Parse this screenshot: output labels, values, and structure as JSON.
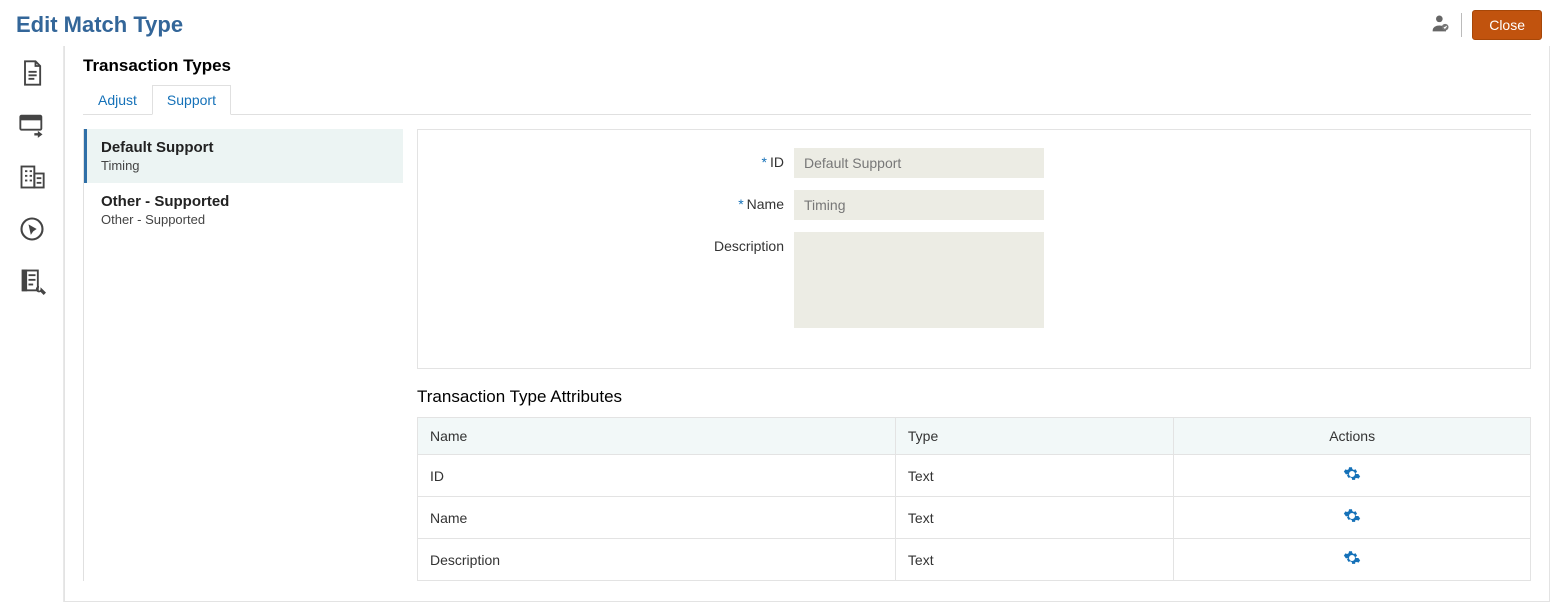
{
  "header": {
    "title": "Edit Match Type",
    "close_label": "Close"
  },
  "section": {
    "title": "Transaction Types"
  },
  "tabs": [
    {
      "label": "Adjust",
      "active": false
    },
    {
      "label": "Support",
      "active": true
    }
  ],
  "type_list": [
    {
      "title": "Default Support",
      "sub": "Timing",
      "selected": true
    },
    {
      "title": "Other - Supported",
      "sub": "Other - Supported",
      "selected": false
    }
  ],
  "form": {
    "id_label": "ID",
    "id_value": "Default Support",
    "name_label": "Name",
    "name_value": "Timing",
    "desc_label": "Description",
    "desc_value": ""
  },
  "attributes": {
    "title": "Transaction Type Attributes",
    "columns": {
      "name": "Name",
      "type": "Type",
      "actions": "Actions"
    },
    "rows": [
      {
        "name": "ID",
        "type": "Text"
      },
      {
        "name": "Name",
        "type": "Text"
      },
      {
        "name": "Description",
        "type": "Text"
      }
    ]
  }
}
